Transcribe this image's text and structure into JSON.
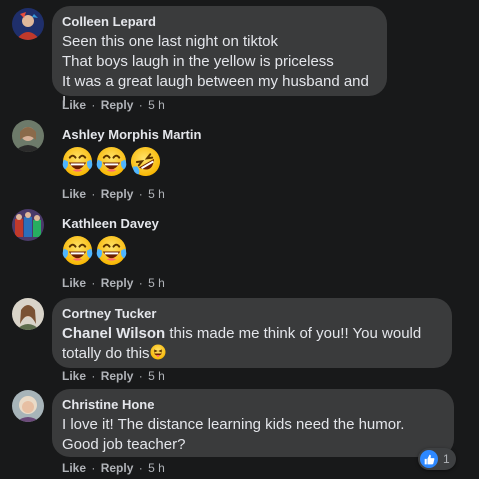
{
  "comments": [
    {
      "author": "Colleen Lepard",
      "lines": [
        "Seen this one last night on tiktok",
        "That boys laugh in the yellow is priceless",
        "It was a great laugh between my husband and I"
      ],
      "like": "Like",
      "reply": "Reply",
      "sep": "·",
      "time": "5 h"
    },
    {
      "author": "Ashley Morphis Martin",
      "emojis": [
        "laughing-tears",
        "laughing-tears",
        "rolling-laughing"
      ],
      "like": "Like",
      "reply": "Reply",
      "sep": "·",
      "time": "5 h"
    },
    {
      "author": "Kathleen Davey",
      "emojis": [
        "laughing-tears",
        "laughing-tears"
      ],
      "like": "Like",
      "reply": "Reply",
      "sep": "·",
      "time": "5 h"
    },
    {
      "author": "Cortney Tucker",
      "mention": "Chanel Wilson",
      "line1_rest": " this made me think of you!! You would",
      "line2": "totally do this",
      "like": "Like",
      "reply": "Reply",
      "sep": "·",
      "time": "5 h"
    },
    {
      "author": "Christine Hone",
      "lines": [
        "I love it! The distance learning kids need the humor.",
        "Good job teacher?"
      ],
      "like": "Like",
      "reply": "Reply",
      "sep": "·",
      "time": "5 h",
      "reaction_count": "1"
    }
  ],
  "colors": {
    "bubble": "#3a3b3c",
    "background": "#18191a",
    "like_blue": "#2d88ff",
    "meta": "#b0b3b8"
  }
}
